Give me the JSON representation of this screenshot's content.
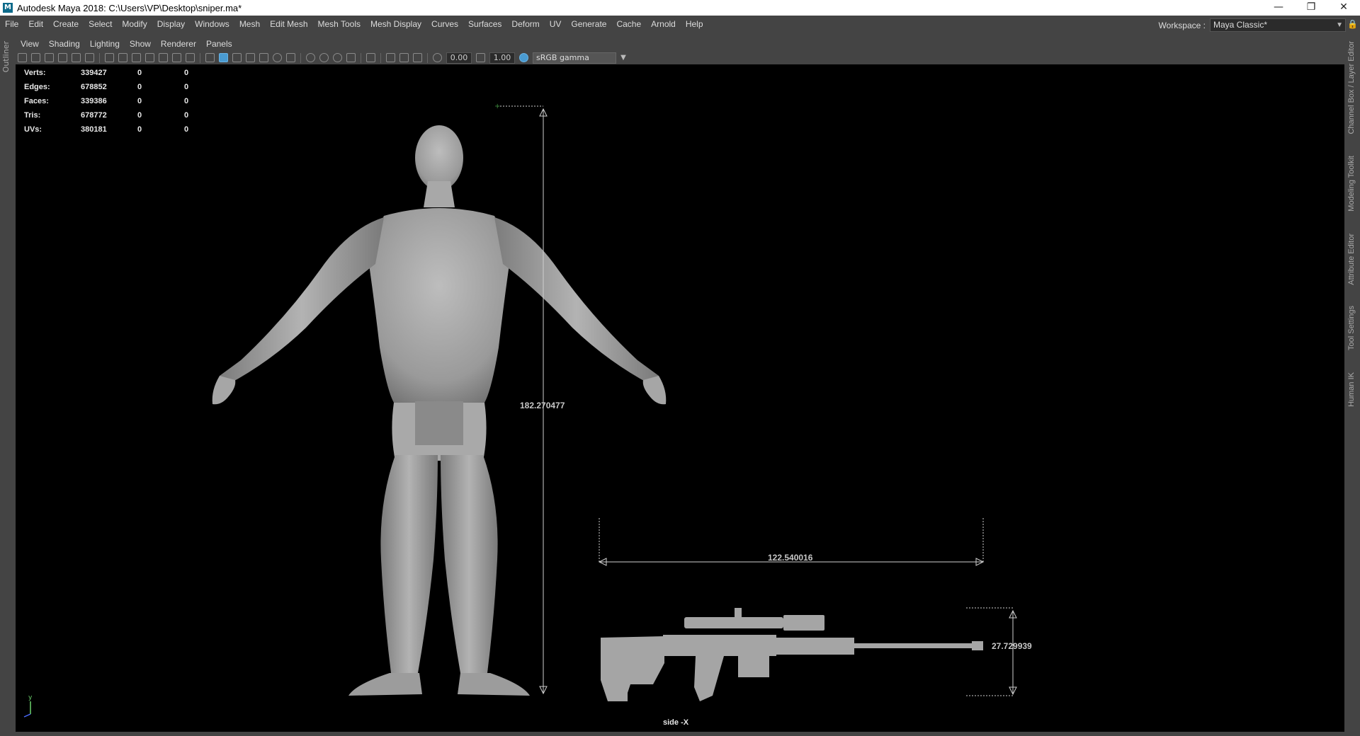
{
  "window": {
    "title": "Autodesk Maya 2018: C:\\Users\\VP\\Desktop\\sniper.ma*",
    "logo": "M",
    "minimize": "—",
    "maximize": "❐",
    "close": "✕"
  },
  "menubar": [
    "File",
    "Edit",
    "Create",
    "Select",
    "Modify",
    "Display",
    "Windows",
    "Mesh",
    "Edit Mesh",
    "Mesh Tools",
    "Mesh Display",
    "Curves",
    "Surfaces",
    "Deform",
    "UV",
    "Generate",
    "Cache",
    "Arnold",
    "Help"
  ],
  "workspace": {
    "label": "Workspace :",
    "value": "Maya Classic*"
  },
  "left_tabs": [
    "Outliner"
  ],
  "right_tabs": [
    "Channel Box / Layer Editor",
    "Modeling Toolkit",
    "Attribute Editor",
    "Tool Settings",
    "Human IK"
  ],
  "panel_menu": [
    "View",
    "Shading",
    "Lighting",
    "Show",
    "Renderer",
    "Panels"
  ],
  "toolbar": {
    "exposure": "0.00",
    "gamma": "1.00",
    "color_space": "sRGB gamma"
  },
  "hud": [
    {
      "label": "Verts:",
      "values": [
        "339427",
        "0",
        "0"
      ]
    },
    {
      "label": "Edges:",
      "values": [
        "678852",
        "0",
        "0"
      ]
    },
    {
      "label": "Faces:",
      "values": [
        "339386",
        "0",
        "0"
      ]
    },
    {
      "label": "Tris:",
      "values": [
        "678772",
        "0",
        "0"
      ]
    },
    {
      "label": "UVs:",
      "values": [
        "380181",
        "0",
        "0"
      ]
    }
  ],
  "dimensions": {
    "height": "182.270477",
    "length": "122.540016",
    "rifle_height": "27.729939"
  },
  "camera_label": "side -X",
  "axis": {
    "x": "x",
    "y": "y"
  }
}
